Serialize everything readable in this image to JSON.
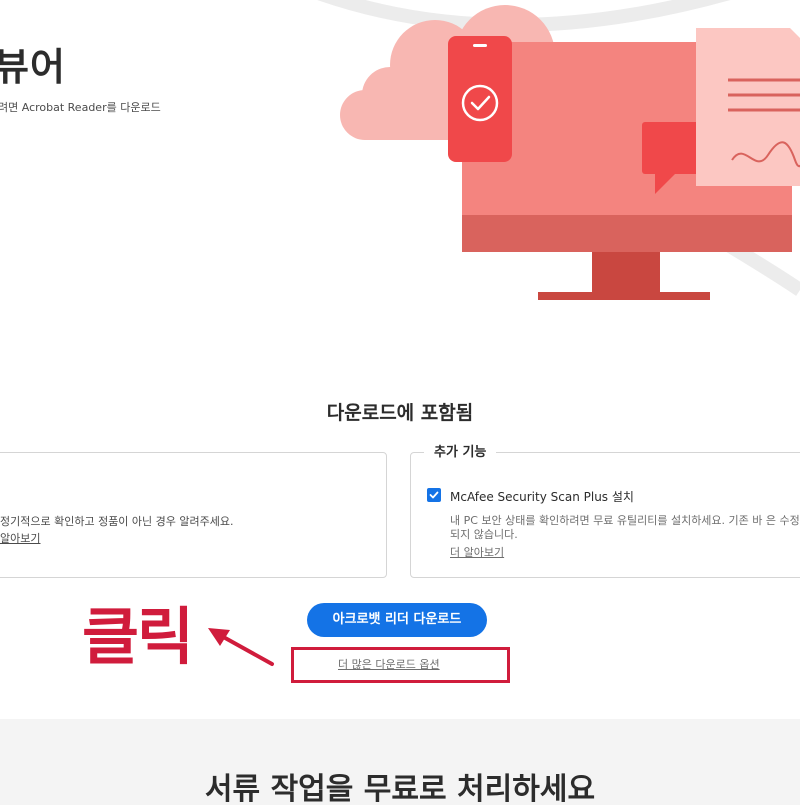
{
  "hero": {
    "title": "뷰어",
    "subtitle": "려면 Acrobat Reader를 다운로드"
  },
  "included": {
    "heading": "다운로드에 포함됨",
    "left_card": {
      "description": "정기적으로 확인하고 정품이 아닌 경우 알려주세요.",
      "link": "알아보기"
    },
    "right_card": {
      "legend": "추가 기능",
      "option_label": "McAfee Security Scan Plus 설치",
      "option_checked": true,
      "option_description": "내 PC 보안 상태를 확인하려면 무료 유틸리티를 설치하세요. 기존 바 은 수정되지 않습니다.",
      "link": "더 알아보기"
    }
  },
  "actions": {
    "download_button": "아크로뱃 리더 다운로드",
    "more_options_link": "더 많은 다운로드 옵션"
  },
  "annotation": {
    "label": "클릭",
    "color": "#d01c3c"
  },
  "bottom": {
    "title": "서류 작업을 무료로 처리하세요"
  },
  "colors": {
    "accent": "#1473e6",
    "illustration_primary": "#f4847f",
    "illustration_dark": "#c94740"
  },
  "icons": [
    "checkmark-icon",
    "document-icon",
    "chat-bubble-icon",
    "signature-icon",
    "arrow-icon"
  ]
}
